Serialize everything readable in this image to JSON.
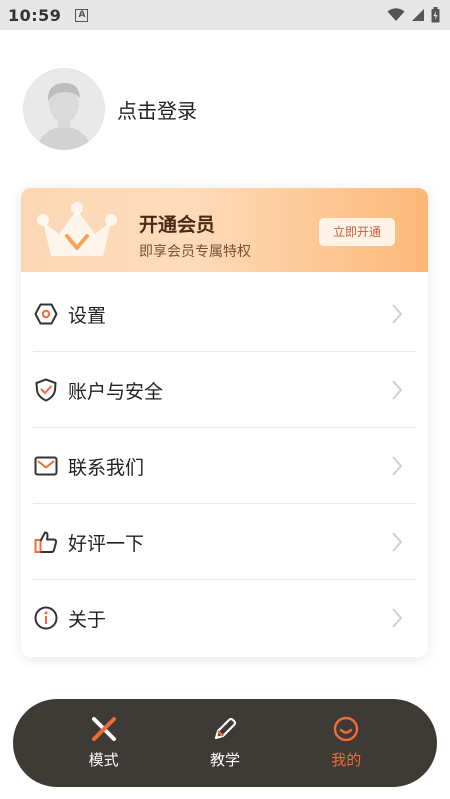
{
  "status_bar": {
    "time": "10:59",
    "notification_letter": "A"
  },
  "profile": {
    "login_text": "点击登录"
  },
  "vip": {
    "title": "开通会员",
    "subtitle": "即享会员专属特权",
    "button_label": "立即开通"
  },
  "menu": {
    "items": [
      {
        "label": "设置",
        "icon": "settings-hexagon-icon"
      },
      {
        "label": "账户与安全",
        "icon": "shield-check-icon"
      },
      {
        "label": "联系我们",
        "icon": "mail-icon"
      },
      {
        "label": "好评一下",
        "icon": "thumbs-up-icon"
      },
      {
        "label": "关于",
        "icon": "info-icon"
      }
    ]
  },
  "nav": {
    "items": [
      {
        "label": "模式",
        "icon": "mode-x-icon",
        "active": false
      },
      {
        "label": "教学",
        "icon": "pencil-icon",
        "active": false
      },
      {
        "label": "我的",
        "icon": "smile-icon",
        "active": true
      }
    ]
  },
  "colors": {
    "accent": "#f36b3a",
    "nav_bg": "#3e3a36",
    "vip_text": "#4a2a12"
  }
}
